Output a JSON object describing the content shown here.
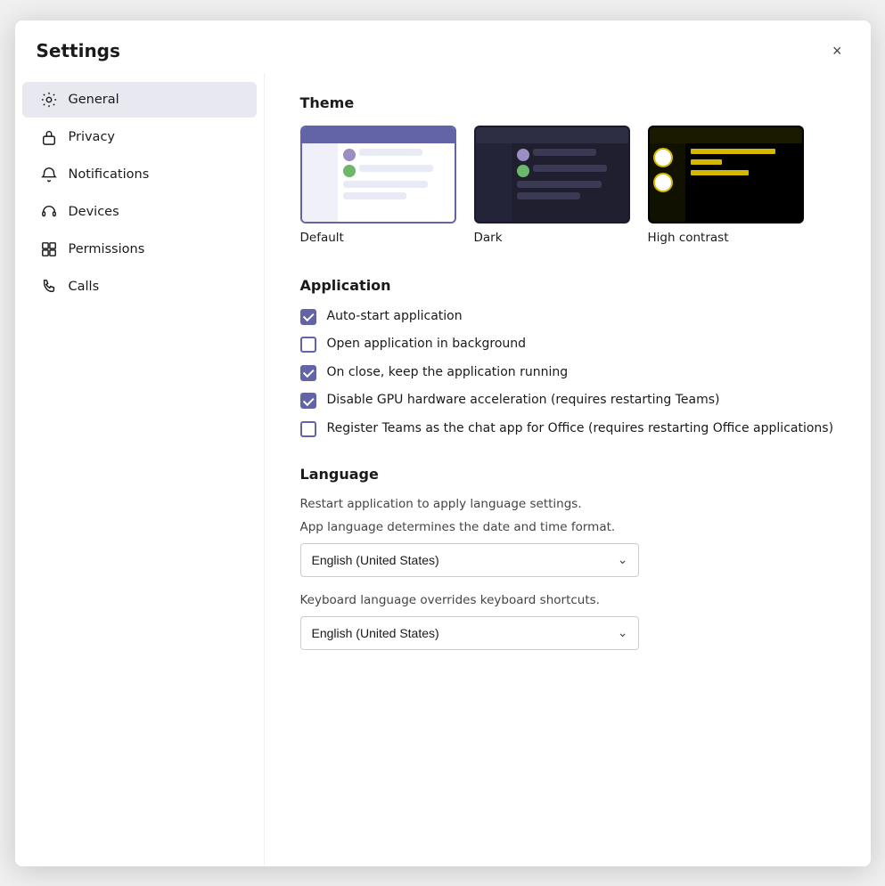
{
  "dialog": {
    "title": "Settings",
    "close_label": "×"
  },
  "sidebar": {
    "items": [
      {
        "id": "general",
        "label": "General",
        "icon": "gear",
        "active": true
      },
      {
        "id": "privacy",
        "label": "Privacy",
        "icon": "lock"
      },
      {
        "id": "notifications",
        "label": "Notifications",
        "icon": "bell"
      },
      {
        "id": "devices",
        "label": "Devices",
        "icon": "headset"
      },
      {
        "id": "permissions",
        "label": "Permissions",
        "icon": "grid"
      },
      {
        "id": "calls",
        "label": "Calls",
        "icon": "phone"
      }
    ]
  },
  "main": {
    "theme": {
      "title": "Theme",
      "options": [
        {
          "id": "default",
          "label": "Default",
          "selected": true
        },
        {
          "id": "dark",
          "label": "Dark",
          "selected": false
        },
        {
          "id": "high-contrast",
          "label": "High contrast",
          "selected": false
        }
      ]
    },
    "application": {
      "title": "Application",
      "checkboxes": [
        {
          "id": "auto-start",
          "label": "Auto-start application",
          "checked": true
        },
        {
          "id": "open-bg",
          "label": "Open application in background",
          "checked": false
        },
        {
          "id": "keep-running",
          "label": "On close, keep the application running",
          "checked": true
        },
        {
          "id": "disable-gpu",
          "label": "Disable GPU hardware acceleration (requires restarting Teams)",
          "checked": true
        },
        {
          "id": "register-chat",
          "label": "Register Teams as the chat app for Office (requires restarting Office applications)",
          "checked": false
        }
      ]
    },
    "language": {
      "title": "Language",
      "app_language_desc": "Restart application to apply language settings.",
      "app_language_label": "App language determines the date and time format.",
      "keyboard_language_label": "Keyboard language overrides keyboard shortcuts.",
      "app_language_value": "English (United States)",
      "keyboard_language_value": "English (United States)"
    }
  }
}
